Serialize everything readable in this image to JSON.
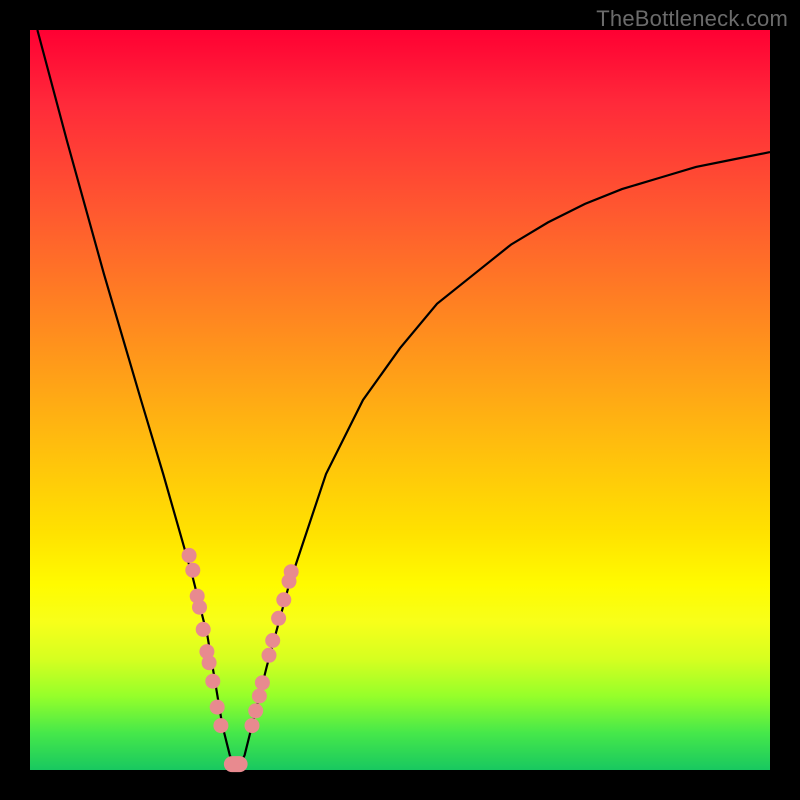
{
  "watermark": "TheBottleneck.com",
  "colors": {
    "dot": "#e88a8f",
    "curve": "#000000",
    "frame": "#000000"
  },
  "chart_data": {
    "type": "line",
    "title": "",
    "xlabel": "",
    "ylabel": "",
    "xlim": [
      0,
      100
    ],
    "ylim": [
      0,
      100
    ],
    "grid": false,
    "legend": false,
    "series": [
      {
        "name": "bottleneck-curve",
        "x": [
          1,
          5,
          10,
          15,
          18,
          20,
          22,
          24,
          25,
          26,
          27,
          28,
          29,
          30,
          32,
          35,
          40,
          45,
          50,
          55,
          60,
          65,
          70,
          75,
          80,
          85,
          90,
          95,
          100
        ],
        "y": [
          100,
          85,
          67,
          50,
          40,
          33,
          26,
          18,
          12,
          6,
          2,
          0,
          2,
          6,
          14,
          25,
          40,
          50,
          57,
          63,
          67,
          71,
          74,
          76.5,
          78.5,
          80,
          81.5,
          82.5,
          83.5
        ]
      }
    ],
    "markers_left": [
      {
        "x": 21.5,
        "y": 29
      },
      {
        "x": 22.0,
        "y": 27
      },
      {
        "x": 22.6,
        "y": 23.5
      },
      {
        "x": 22.9,
        "y": 22
      },
      {
        "x": 23.4,
        "y": 19
      },
      {
        "x": 23.9,
        "y": 16
      },
      {
        "x": 24.2,
        "y": 14.5
      },
      {
        "x": 24.7,
        "y": 12
      },
      {
        "x": 25.3,
        "y": 8.5
      },
      {
        "x": 25.8,
        "y": 6
      }
    ],
    "markers_right": [
      {
        "x": 30.0,
        "y": 6
      },
      {
        "x": 30.5,
        "y": 8
      },
      {
        "x": 31.0,
        "y": 10
      },
      {
        "x": 31.4,
        "y": 11.8
      },
      {
        "x": 32.3,
        "y": 15.5
      },
      {
        "x": 32.8,
        "y": 17.5
      },
      {
        "x": 33.6,
        "y": 20.5
      },
      {
        "x": 34.3,
        "y": 23
      },
      {
        "x": 35.0,
        "y": 25.5
      },
      {
        "x": 35.3,
        "y": 26.8
      }
    ],
    "trough_pill": {
      "x_center": 27.8,
      "y": 0.8,
      "half_width": 1.6
    }
  }
}
